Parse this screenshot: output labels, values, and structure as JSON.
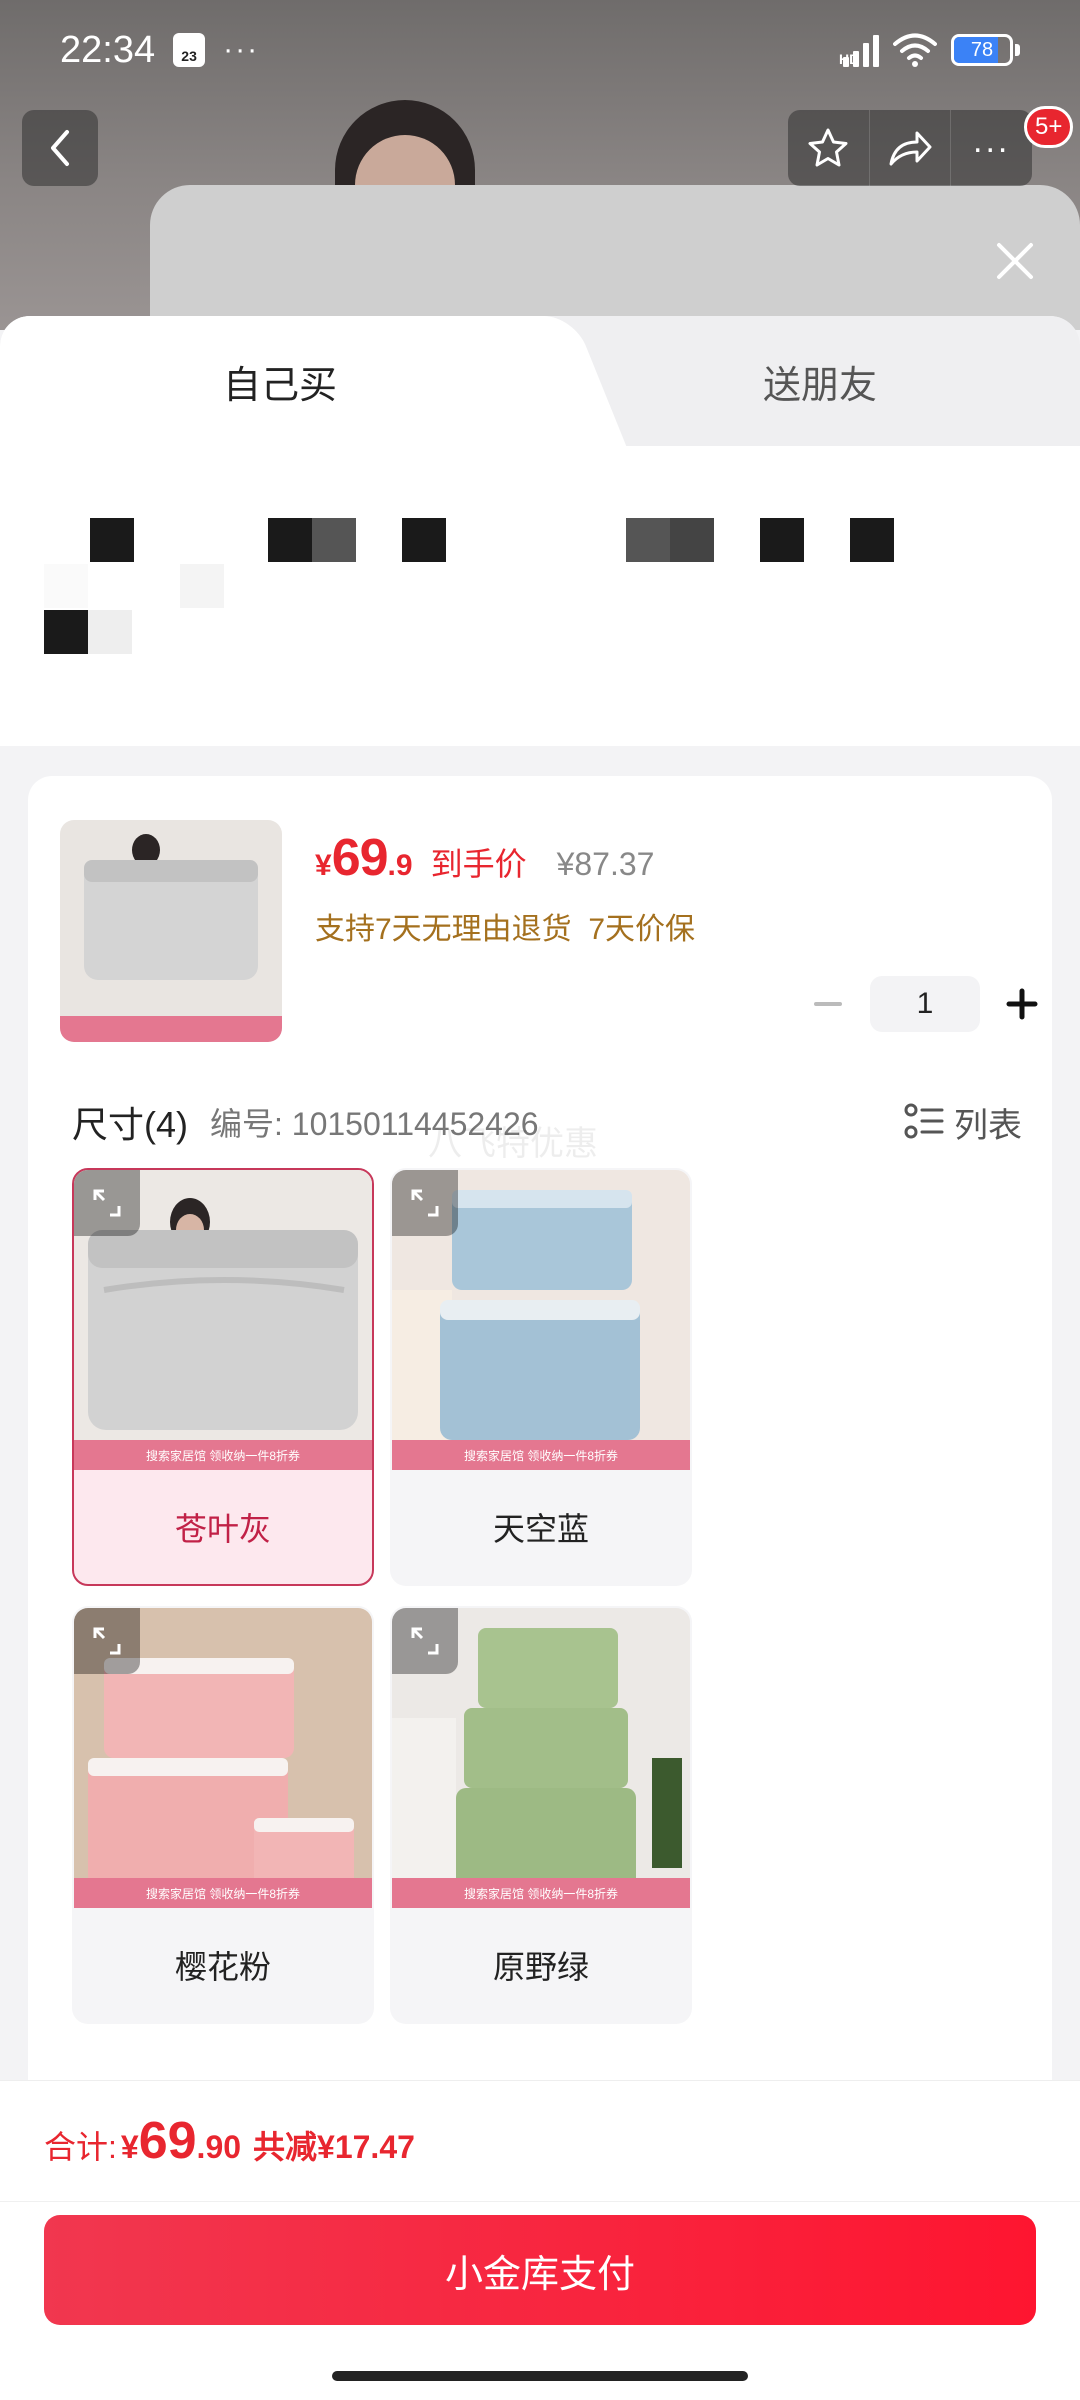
{
  "status_bar": {
    "time": "22:34",
    "calendar_day": "23",
    "network": "HD",
    "battery": "78",
    "battery_fraction": 0.78
  },
  "top_actions": {
    "notification_count": "5+"
  },
  "tabs": [
    {
      "label": "自己买",
      "active": true
    },
    {
      "label": "送朋友",
      "active": false
    }
  ],
  "product": {
    "price_currency": "¥",
    "price_integer": "69",
    "price_decimal": ".9",
    "price_tag": "到手价",
    "original_price": "¥87.37",
    "service_text": "支持7天无理由退货  7天价保",
    "quantity": "1"
  },
  "size": {
    "title": "尺寸(4)",
    "code": "编号: 10150114452426",
    "list_label": "列表",
    "watermark": "八飞特优惠"
  },
  "variants": [
    {
      "label": "苍叶灰",
      "selected": true,
      "color": "#c9c9c9"
    },
    {
      "label": "天空蓝",
      "selected": false,
      "color": "#a9c6d9"
    },
    {
      "label": "樱花粉",
      "selected": false,
      "color": "#f1b3b3"
    },
    {
      "label": "原野绿",
      "selected": false,
      "color": "#a8c38f"
    }
  ],
  "banner_text": "搜索家居馆 领收纳一件8折券",
  "footer": {
    "total_label": "合计:",
    "total_currency": "¥",
    "total_integer": "69",
    "total_decimal": ".90",
    "total_savings": "共减¥17.47",
    "pay_button": "小金库支付"
  },
  "colors": {
    "accent_red": "#e8262f",
    "gold": "#a4701e",
    "selected_pink": "#fde8ee"
  }
}
